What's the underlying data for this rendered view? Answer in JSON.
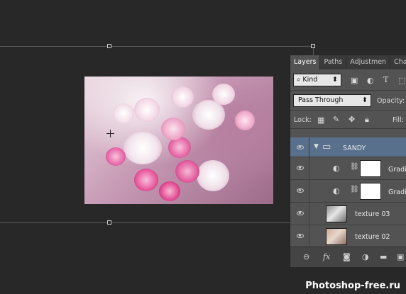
{
  "layers_panel": {
    "tabs": [
      "Layers",
      "Paths",
      "Adjustmen",
      "Chan"
    ],
    "filter": {
      "kind_label": "Kind"
    },
    "blend_mode": "Pass Through",
    "opacity_label": "Opacity:",
    "lock_label": "Lock:",
    "fill_label": "Fill:",
    "layers": [
      {
        "name": "SANDY",
        "type": "group",
        "selected": true
      },
      {
        "name": "Gradi",
        "type": "adjustment"
      },
      {
        "name": "Gradi",
        "type": "adjustment"
      },
      {
        "name": "texture 03",
        "type": "image"
      },
      {
        "name": "texture 02",
        "type": "image"
      }
    ],
    "footer_icons": [
      "link-icon",
      "fx-icon",
      "mask-icon",
      "adjustment-icon",
      "folder-icon",
      "new-layer-icon"
    ]
  },
  "watermark": "Photoshop-free.ru",
  "colors": {
    "background": "#282828",
    "panel": "#535353",
    "selection": "#58708c"
  }
}
